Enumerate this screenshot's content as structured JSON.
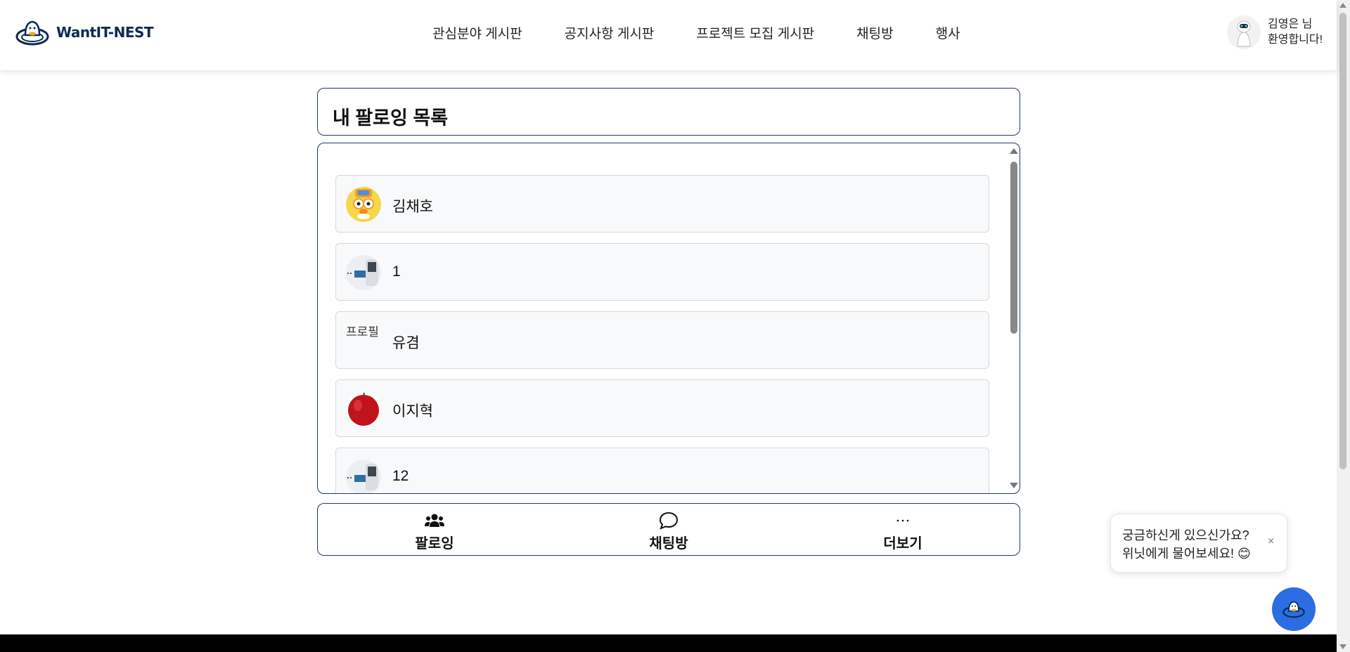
{
  "header": {
    "logo_text": "WantIT-NEST",
    "nav": [
      {
        "label": "관심분야 게시판"
      },
      {
        "label": "공지사항 게시판"
      },
      {
        "label": "프로젝트 모집 게시판"
      },
      {
        "label": "채팅방"
      },
      {
        "label": "행사"
      }
    ],
    "user": {
      "greeting_line1": "김영은 님",
      "greeting_line2": "환영합니다!"
    }
  },
  "main": {
    "title": "내 팔로잉 목록",
    "following": [
      {
        "name": "김채호",
        "avatar": "pororo-avatar"
      },
      {
        "name": "1",
        "avatar": "device-avatar"
      },
      {
        "name": "유겸",
        "avatar": "broken-image-avatar",
        "alt_text": "프로필"
      },
      {
        "name": "이지혁",
        "avatar": "apple-avatar"
      },
      {
        "name": "12",
        "avatar": "device-avatar"
      }
    ]
  },
  "tabs": [
    {
      "label": "팔로잉",
      "icon": "users-icon"
    },
    {
      "label": "채팅방",
      "icon": "chat-bubble-icon"
    },
    {
      "label": "더보기",
      "icon": "ellipsis-icon"
    }
  ],
  "chatbot": {
    "line1": "궁금하신게 있으신가요?",
    "line2": "위닛에게 물어보세요! 😊",
    "close": "×"
  },
  "colors": {
    "border": "#1f3a66",
    "fab": "#2b6de3",
    "logo_text": "#0d2a55"
  }
}
